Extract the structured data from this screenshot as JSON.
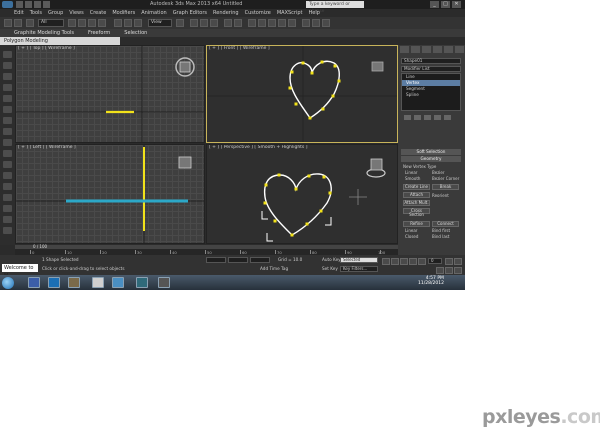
{
  "window": {
    "title": "Autodesk 3ds Max 2013 x64  Untitled",
    "search_placeholder": "Type a keyword or phrase",
    "window_buttons": [
      "_",
      "□",
      "✕"
    ]
  },
  "menu": [
    "Edit",
    "Tools",
    "Group",
    "Views",
    "Create",
    "Modifiers",
    "Animation",
    "Graph Editors",
    "Rendering",
    "Customize",
    "MAXScript",
    "Help"
  ],
  "toolbar": {
    "selection_filter": "All",
    "reference_coord": "View"
  },
  "ribbon": {
    "tabs": [
      "Graphite Modeling Tools",
      "Freeform",
      "Selection"
    ],
    "panel_label": "Polygon Modeling"
  },
  "viewports": [
    {
      "label": "[ + ] [ Top ] [ Wireframe ]"
    },
    {
      "label": "[ + ] [ Front ] [ Wireframe ]"
    },
    {
      "label": "[ + ] [ Left ] [ Wireframe ]"
    },
    {
      "label": "[ + ] [ Perspective ] [ Smooth + Highlights ]"
    }
  ],
  "command_panel": {
    "object_name": "Shape01",
    "modifier_list": "Modifier List",
    "stack": [
      {
        "label": "Line",
        "selected": false
      },
      {
        "label": "Vertex",
        "selected": true
      },
      {
        "label": "Segment",
        "selected": false
      },
      {
        "label": "Spline",
        "selected": false
      }
    ],
    "rollouts": {
      "soft_selection": "Soft Selection",
      "geometry": "Geometry"
    },
    "new_vertex_type": "New Vertex Type",
    "vertex_types": [
      "Linear",
      "Bezier",
      "Smooth",
      "Bezier Corner"
    ],
    "buttons": [
      "Create Line",
      "Break",
      "Attach",
      "Attach Mult.",
      "Cross Section",
      "Refine",
      "Connect"
    ],
    "checkboxes": [
      "Reorient",
      "Linear",
      "Bind first",
      "Closed",
      "Bind last"
    ]
  },
  "timeline": {
    "range": "0 / 100",
    "ticks": [
      "0",
      "10",
      "20",
      "30",
      "40",
      "50",
      "60",
      "70",
      "80",
      "90",
      "100"
    ]
  },
  "status": {
    "selection": "1 Shape Selected",
    "prompt": "Click or click-and-drag to select objects",
    "grid": "Grid = 10.0",
    "add_time_tag": "Add Time Tag",
    "auto_key": "Auto Key",
    "selected": "Selected",
    "set_key": "Set Key",
    "key_filters": "Key Filters...",
    "frame": "0"
  },
  "maxscript_label": "Welcome to M",
  "taskbar": {
    "time": "4:57 PM",
    "date": "11/28/2012"
  },
  "watermark": {
    "text": "pxleyes",
    "suffix": ".com"
  },
  "colors": {
    "selection_yellow": "#f2e21a",
    "spline_white": "#ffffff",
    "helper_cyan": "#2ca8c8",
    "active_viewport_border": "#c8b45a"
  }
}
